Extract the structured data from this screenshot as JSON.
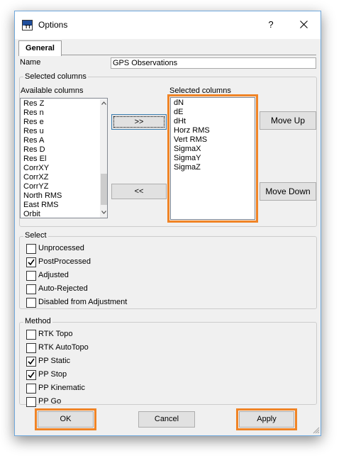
{
  "window": {
    "title": "Options",
    "help_glyph": "?",
    "close_icon": "close-icon",
    "app_icon_text": "TT"
  },
  "tabs": [
    {
      "label": "General",
      "selected": true
    }
  ],
  "name_field": {
    "label": "Name",
    "value": "GPS Observations"
  },
  "columns_group": {
    "label": "Selected columns",
    "available_label": "Available columns",
    "available": [
      "Res Z",
      "Res n",
      "Res e",
      "Res u",
      "Res A",
      "Res D",
      "Res El",
      "CorrXY",
      "CorrXZ",
      "CorrYZ",
      "North RMS",
      "East RMS",
      "Orbit"
    ],
    "selected_label": "Selected columns",
    "selected": [
      "dN",
      "dE",
      "dHt",
      "Horz RMS",
      "Vert RMS",
      "SigmaX",
      "SigmaY",
      "SigmaZ"
    ],
    "add_label": ">>",
    "remove_label": "<<",
    "move_up_label": "Move Up",
    "move_down_label": "Move Down"
  },
  "select_group": {
    "label": "Select",
    "options": [
      {
        "label": "Unprocessed",
        "checked": false
      },
      {
        "label": "PostProcessed",
        "checked": true
      },
      {
        "label": "Adjusted",
        "checked": false
      },
      {
        "label": "Auto-Rejected",
        "checked": false
      },
      {
        "label": "Disabled from Adjustment",
        "checked": false
      }
    ]
  },
  "method_group": {
    "label": "Method",
    "options": [
      {
        "label": "RTK Topo",
        "checked": false
      },
      {
        "label": "RTK AutoTopo",
        "checked": false
      },
      {
        "label": "PP Static",
        "checked": true
      },
      {
        "label": "PP Stop",
        "checked": true
      },
      {
        "label": "PP Kinematic",
        "checked": false
      },
      {
        "label": "PP Go",
        "checked": false
      }
    ]
  },
  "buttons": {
    "ok": "OK",
    "cancel": "Cancel",
    "apply": "Apply"
  },
  "colors": {
    "highlight": "#f08426",
    "dialog_bg": "#f0f0f0",
    "button_bg": "#e1e1e1"
  }
}
